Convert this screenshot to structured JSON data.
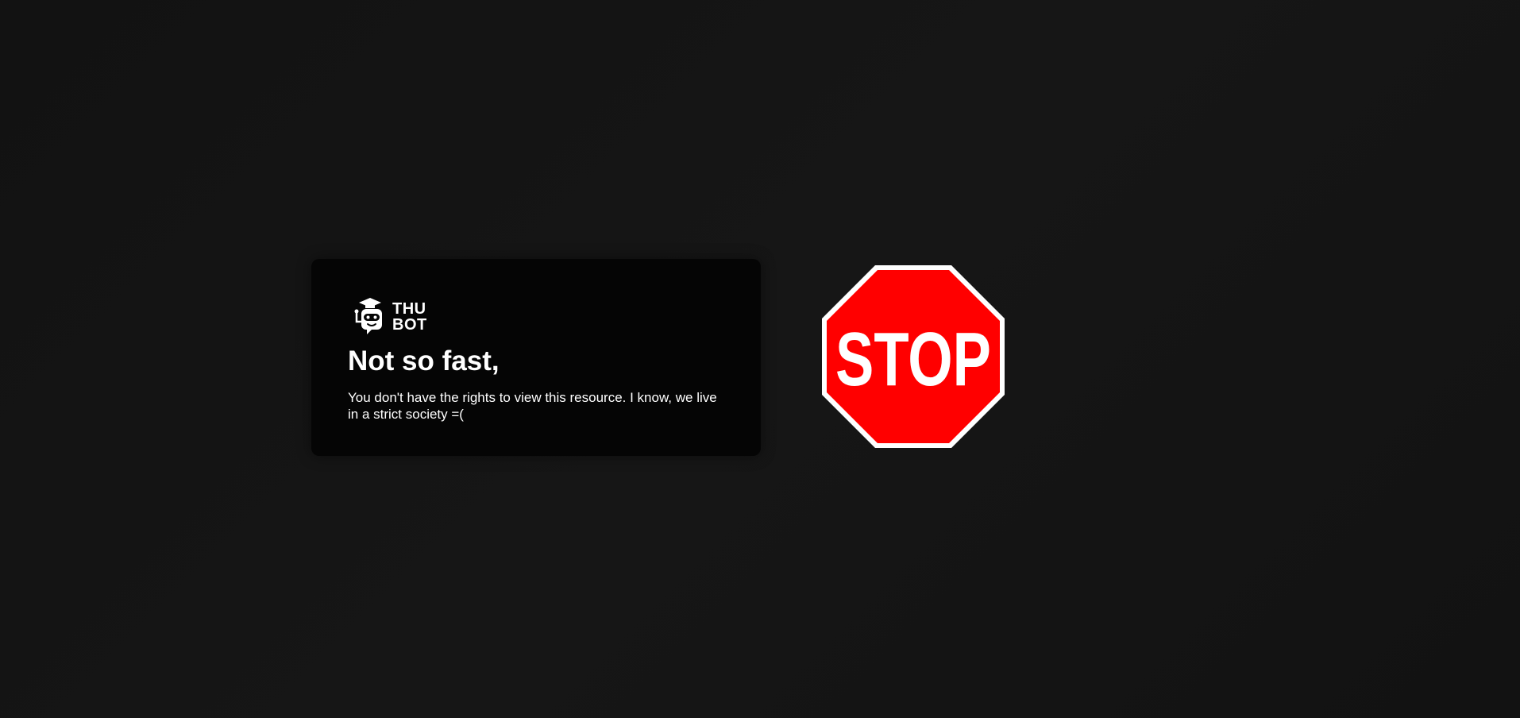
{
  "brand": {
    "line1": "THU",
    "line2": "BOT"
  },
  "error": {
    "title": "Not so fast,",
    "message": "You don't have the rights to view this resource. I know, we live in a strict society =("
  },
  "stop_sign": {
    "text": "STOP",
    "color": "#ff0000"
  },
  "colors": {
    "background": "#141414",
    "card": "#050505",
    "text": "#ffffff"
  }
}
